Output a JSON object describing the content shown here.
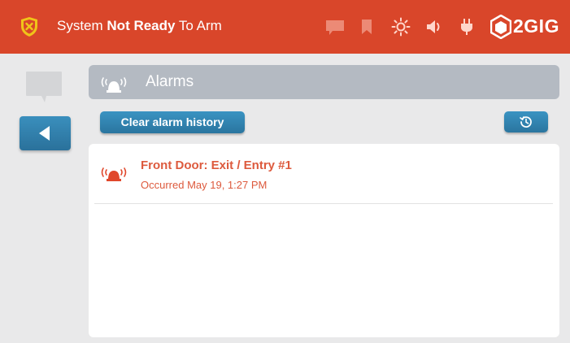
{
  "status": {
    "prefix": "System ",
    "emphasis": "Not Ready",
    "suffix": " To Arm"
  },
  "brand": {
    "name": "2GIG"
  },
  "header": {
    "title": "Alarms"
  },
  "actions": {
    "clear_label": "Clear alarm history"
  },
  "alarms": [
    {
      "title": "Front Door: Exit / Entry #1",
      "subtitle": "Occurred May 19, 1:27 PM"
    }
  ],
  "colors": {
    "topbar": "#d9462a",
    "accent_blue": "#2a759f",
    "alarm_text": "#dd5a3d",
    "header_gray": "#b4bac2"
  },
  "icons": [
    "shield-x-icon",
    "message-icon",
    "bookmark-icon",
    "brightness-icon",
    "volume-icon",
    "power-plug-icon",
    "brand-logo-icon",
    "back-arrow-icon",
    "siren-icon",
    "history-clock-icon"
  ]
}
